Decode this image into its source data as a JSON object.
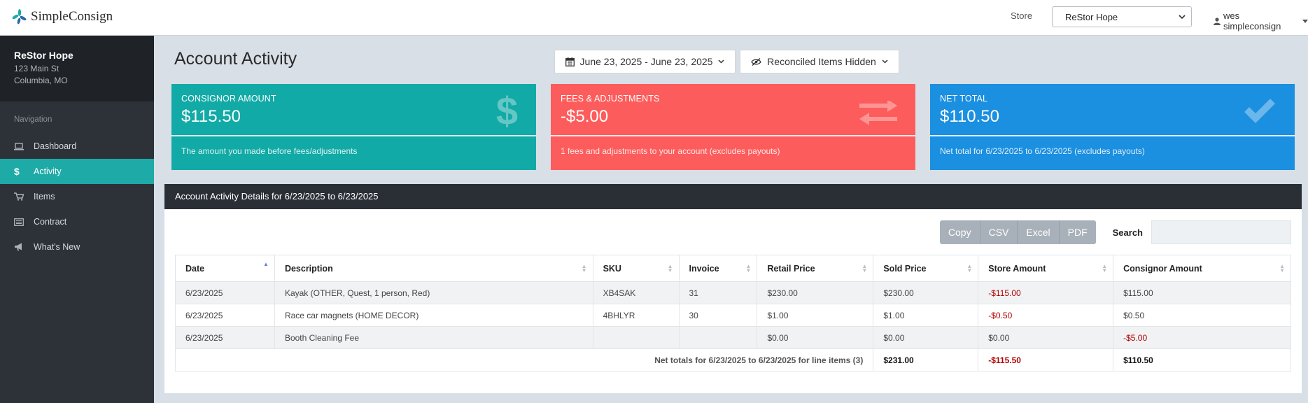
{
  "app": {
    "name": "SimpleConsign"
  },
  "header": {
    "store_label": "Store",
    "store_selected": "ReStor Hope",
    "user": "wes simpleconsign"
  },
  "sidebar": {
    "store_name": "ReStor Hope",
    "address_line1": "123 Main St",
    "address_line2": "Columbia, MO",
    "nav_heading": "Navigation",
    "items": [
      {
        "label": "Dashboard",
        "icon": "laptop-icon"
      },
      {
        "label": "Activity",
        "icon": "dollar-icon",
        "active": true
      },
      {
        "label": "Items",
        "icon": "cart-icon"
      },
      {
        "label": "Contract",
        "icon": "list-icon"
      },
      {
        "label": "What's New",
        "icon": "megaphone-icon"
      }
    ]
  },
  "main": {
    "title": "Account Activity",
    "date_range": "June 23, 2025 - June 23, 2025",
    "reconciled": "Reconciled Items Hidden"
  },
  "cards": [
    {
      "title": "CONSIGNOR AMOUNT",
      "value": "$115.50",
      "desc": "The amount you made before fees/adjustments",
      "icon": "dollar-icon",
      "color": "#12aaa6"
    },
    {
      "title": "FEES & ADJUSTMENTS",
      "value": "-$5.00",
      "desc": "1 fees and adjustments to your account (excludes payouts)",
      "icon": "exchange-icon",
      "color": "#fd5c5c"
    },
    {
      "title": "NET TOTAL",
      "value": "$110.50",
      "desc": "Net total for 6/23/2025 to 6/23/2025 (excludes payouts)",
      "icon": "check-icon",
      "color": "#1b8fe0"
    }
  ],
  "details": {
    "heading": "Account Activity Details for 6/23/2025 to 6/23/2025",
    "buttons": {
      "copy": "Copy",
      "csv": "CSV",
      "excel": "Excel",
      "pdf": "PDF"
    },
    "search_label": "Search",
    "columns": [
      "Date",
      "Description",
      "SKU",
      "Invoice",
      "Retail Price",
      "Sold Price",
      "Store Amount",
      "Consignor Amount"
    ],
    "rows": [
      {
        "date": "6/23/2025",
        "desc": "Kayak (OTHER, Quest, 1 person, Red)",
        "sku": "XB4SAK",
        "invoice": "31",
        "retail": "$230.00",
        "sold": "$230.00",
        "store": "-$115.00",
        "consignor": "$115.00"
      },
      {
        "date": "6/23/2025",
        "desc": "Race car magnets (HOME DECOR)",
        "sku": "4BHLYR",
        "invoice": "30",
        "retail": "$1.00",
        "sold": "$1.00",
        "store": "-$0.50",
        "consignor": "$0.50"
      },
      {
        "date": "6/23/2025",
        "desc": "Booth Cleaning Fee",
        "sku": "",
        "invoice": "",
        "retail": "$0.00",
        "sold": "$0.00",
        "store": "$0.00",
        "consignor": "-$5.00"
      }
    ],
    "totals": {
      "label": "Net totals for 6/23/2025 to 6/23/2025 for line items (3)",
      "sold": "$231.00",
      "store": "-$115.50",
      "consignor": "$110.50"
    }
  }
}
